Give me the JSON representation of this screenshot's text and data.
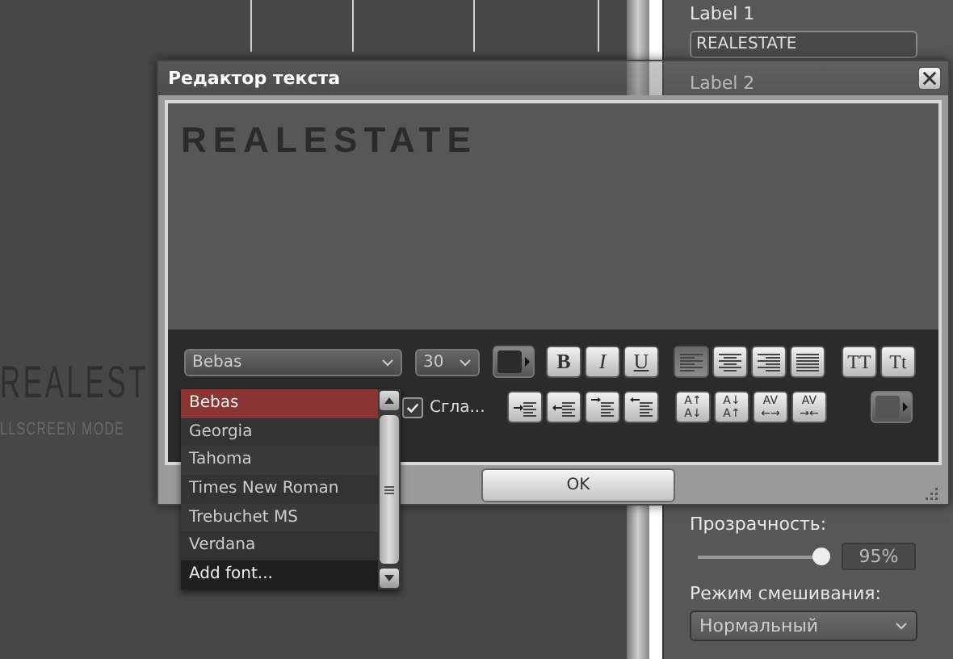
{
  "canvas": {
    "title_fragment": "REALEST",
    "subtitle_fragment": "LLSCREEN MODE"
  },
  "properties_panel": {
    "label_1": "Label 1",
    "label_1_value": "REALESTATE",
    "label_2": "Label 2",
    "opacity_label": "Прозрачность:",
    "opacity": {
      "level": 0.95,
      "reading": "95%"
    },
    "blend_label": "Режим смешивания:",
    "blend_value": "Нормальный"
  },
  "dialog": {
    "title": "Редактор текста",
    "preview_text": "REALESTATE",
    "font": "Bebas",
    "size": "30",
    "format_buttons": [
      {
        "label": "B",
        "kind": "bold"
      },
      {
        "label": "I",
        "kind": "italic"
      },
      {
        "label": "U",
        "kind": "underline"
      }
    ],
    "align_buttons": [
      {
        "kind": "left",
        "selected": true
      },
      {
        "kind": "center",
        "selected": false
      },
      {
        "kind": "right",
        "selected": false
      },
      {
        "kind": "justify",
        "selected": false
      }
    ],
    "case_buttons": [
      {
        "label": "TT"
      },
      {
        "label": "Tt"
      }
    ],
    "antialias": {
      "label": "Сгла...",
      "checked": true
    },
    "indent_buttons": [
      {
        "kind": "indent-left"
      },
      {
        "kind": "outdent-left"
      },
      {
        "kind": "indent-first"
      },
      {
        "kind": "outdent-first"
      }
    ],
    "spacing_buttons": [
      {
        "glyph_top": "A↑",
        "glyph_bottom": "A↓"
      },
      {
        "glyph_top": "A↓",
        "glyph_bottom": "A↑"
      },
      {
        "glyph_top": "AV",
        "glyph_bottom": "←→"
      },
      {
        "glyph_top": "AV",
        "glyph_bottom": "→←"
      }
    ],
    "ok": "OK"
  },
  "font_list": {
    "items": [
      {
        "label": "Bebas",
        "kind": "font",
        "selected": true
      },
      {
        "label": "Georgia",
        "kind": "font",
        "selected": false
      },
      {
        "label": "Tahoma",
        "kind": "font",
        "selected": false
      },
      {
        "label": "Times New Roman",
        "kind": "font",
        "selected": false
      },
      {
        "label": "Trebuchet MS",
        "kind": "font",
        "selected": false
      },
      {
        "label": "Verdana",
        "kind": "font",
        "selected": false
      },
      {
        "label": "Add font...",
        "kind": "action",
        "selected": false
      }
    ]
  }
}
